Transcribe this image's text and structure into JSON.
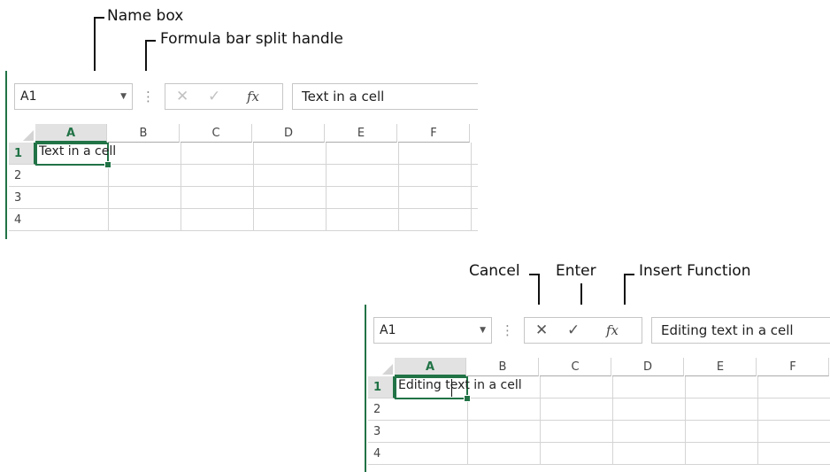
{
  "callouts": {
    "name_box": "Name box",
    "split_handle": "Formula bar split handle",
    "cancel": "Cancel",
    "enter": "Enter",
    "insert_function": "Insert Function"
  },
  "columns": [
    "A",
    "B",
    "C",
    "D",
    "E",
    "F"
  ],
  "rows": [
    "1",
    "2",
    "3",
    "4"
  ],
  "icons": {
    "dropdown": "▼",
    "split_handle": "⋮",
    "cancel": "✕",
    "enter": "✓",
    "insert_function": "fx"
  },
  "screenshot1": {
    "name_box_value": "A1",
    "formula_bar_value": "Text in a cell",
    "cell_a1_value": "Text in a cell",
    "buttons_enabled": false
  },
  "screenshot2": {
    "name_box_value": "A1",
    "formula_bar_value": "Editing text in a cell",
    "cell_a1_value": "Editing text in a cell",
    "buttons_enabled": true
  },
  "colors": {
    "accent": "#217346",
    "gridline": "#d4d4d4",
    "disabled": "#c2c2c2",
    "enabled": "#555555"
  }
}
